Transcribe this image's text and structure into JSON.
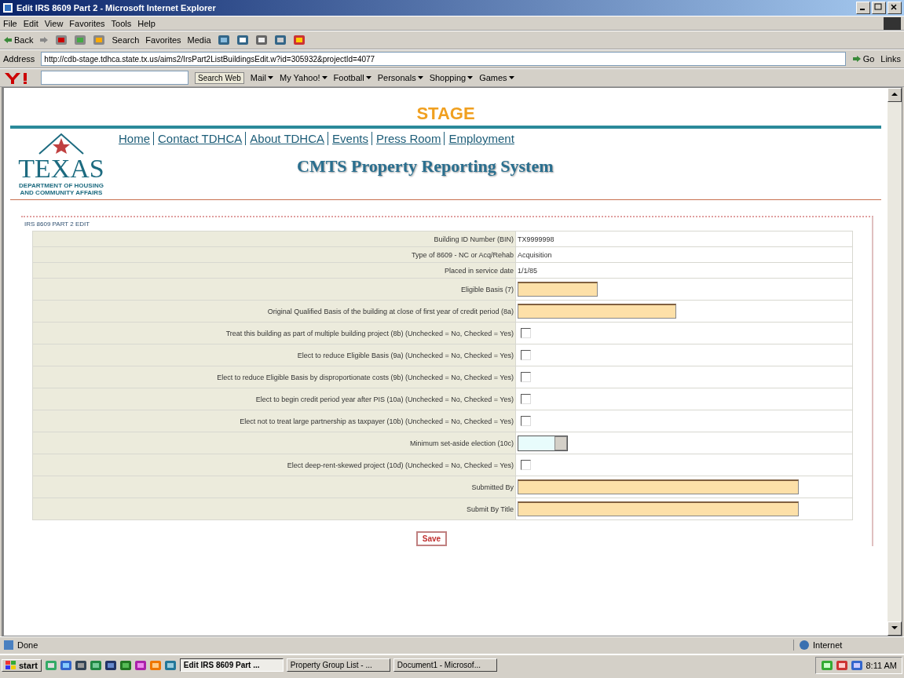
{
  "window": {
    "title": "Edit IRS 8609 Part 2 - Microsoft Internet Explorer"
  },
  "menu": [
    "File",
    "Edit",
    "View",
    "Favorites",
    "Tools",
    "Help"
  ],
  "toolbar": {
    "back": "Back",
    "search": "Search",
    "favorites": "Favorites",
    "media": "Media"
  },
  "address_bar": {
    "label": "Address",
    "value": "http://cdb-stage.tdhca.state.tx.us/aims2/IrsPart2ListBuildingsEdit.w?id=305932&projectId=4077",
    "go": "Go",
    "links": "Links"
  },
  "yahoo_toolbar": {
    "search_button": "Search Web",
    "items": [
      "Mail",
      "My Yahoo!",
      "Football",
      "Personals",
      "Shopping",
      "Games"
    ]
  },
  "page": {
    "banner": "STAGE",
    "nav": [
      "Home",
      "Contact TDHCA",
      "About TDHCA",
      "Events",
      "Press Room",
      "Employment"
    ],
    "logo": {
      "name": "TEXAS",
      "line_1": "DEPARTMENT OF HOUSING",
      "line_2": "AND COMMUNITY AFFAIRS"
    },
    "heading": "CMTS Property Reporting System",
    "section_title": "IRS 8609 PART 2 EDIT",
    "rows": [
      {
        "label": "Building ID Number (BIN)",
        "kind": "text",
        "value": "TX9999998"
      },
      {
        "label": "Type of 8609 - NC or Acq/Rehab",
        "kind": "text",
        "value": "Acquisition"
      },
      {
        "label": "Placed in service date",
        "kind": "text",
        "value": "1/1/85"
      },
      {
        "label": "Eligible Basis (7)",
        "kind": "short-input"
      },
      {
        "label": "Original Qualified Basis of the building at close of first year of credit period (8a)",
        "kind": "medium-input"
      },
      {
        "label": "Treat this building as part of multiple building project (8b) (Unchecked = No, Checked = Yes)",
        "kind": "checkbox",
        "checked": false
      },
      {
        "label": "Elect to reduce Eligible Basis (9a) (Unchecked = No, Checked = Yes)",
        "kind": "checkbox",
        "checked": false
      },
      {
        "label": "Elect to reduce Eligible Basis by disproportionate costs (9b) (Unchecked = No, Checked = Yes)",
        "kind": "checkbox",
        "checked": false
      },
      {
        "label": "Elect to begin credit period year after PIS (10a) (Unchecked = No, Checked = Yes)",
        "kind": "checkbox",
        "checked": false
      },
      {
        "label": "Elect not to treat large partnership as taxpayer (10b) (Unchecked = No, Checked = Yes)",
        "kind": "checkbox",
        "checked": false
      },
      {
        "label": "Minimum set-aside election (10c)",
        "kind": "select"
      },
      {
        "label": "Elect deep-rent-skewed project (10d) (Unchecked = No, Checked = Yes)",
        "kind": "checkbox",
        "checked": false
      },
      {
        "label": "Submitted By",
        "kind": "long-input"
      },
      {
        "label": "Submit By Title",
        "kind": "long-input"
      }
    ],
    "save_button": "Save"
  },
  "status_bar": {
    "text": "Done",
    "zone": "Internet"
  },
  "taskbar": {
    "start": "start",
    "windows": [
      {
        "label": "Edit IRS 8609 Part ...",
        "selected": true
      },
      {
        "label": "Property Group List - ...",
        "selected": false
      },
      {
        "label": "Document1 - Microsof...",
        "selected": false
      }
    ],
    "clock": "8:11 AM"
  }
}
